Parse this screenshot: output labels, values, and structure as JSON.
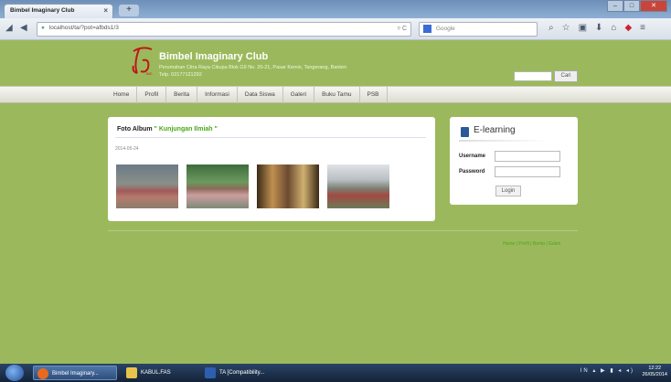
{
  "browser": {
    "tab_title": "Bimbel Imaginary Club",
    "tab_close": "×",
    "new_tab": "+",
    "window_buttons": [
      "–",
      "□",
      "✕"
    ],
    "url": "localhost/ta/?pot=afbds1/3",
    "search_engine": "Google",
    "url_right": "▿ C",
    "toolbar_icons": [
      "search-icon",
      "star-icon",
      "bookmarks-icon",
      "download-icon",
      "home-icon",
      "addon-icon",
      "menu-icon"
    ]
  },
  "header": {
    "site_name": "Bimbel Imaginary Club",
    "address": "Perumahan Citra Raya Cikupa Blok G9 No. 20-21, Pasar Kemis, Tangerang, Banten",
    "phone": "Telp. 02177121292",
    "search_button": "Cari"
  },
  "menu": {
    "items": [
      "Home",
      "Profil",
      "Berita",
      "Informasi",
      "Data Siswa",
      "Galeri",
      "Buku Tamu",
      "PSB"
    ]
  },
  "album": {
    "title_prefix": "Foto Album",
    "title_highlight": "\" Kunjungan Ilmiah \"",
    "date": "2014-05-24",
    "photos": [
      "photo-1",
      "photo-2",
      "photo-3",
      "photo-4"
    ]
  },
  "elearning": {
    "title": "E-learning",
    "username_label": "Username",
    "password_label": "Password",
    "login_button": "Login"
  },
  "footer": {
    "links": "Home | Profil | Berita | Galeri"
  },
  "taskbar": {
    "items": [
      "Bimbel Imaginary...",
      "KABUL.FAS",
      "TA [Compatibility..."
    ],
    "tray": "IN ▴ ▶ ▮ ◂ ◂)",
    "time": "12:22",
    "date": "26/05/2014"
  }
}
